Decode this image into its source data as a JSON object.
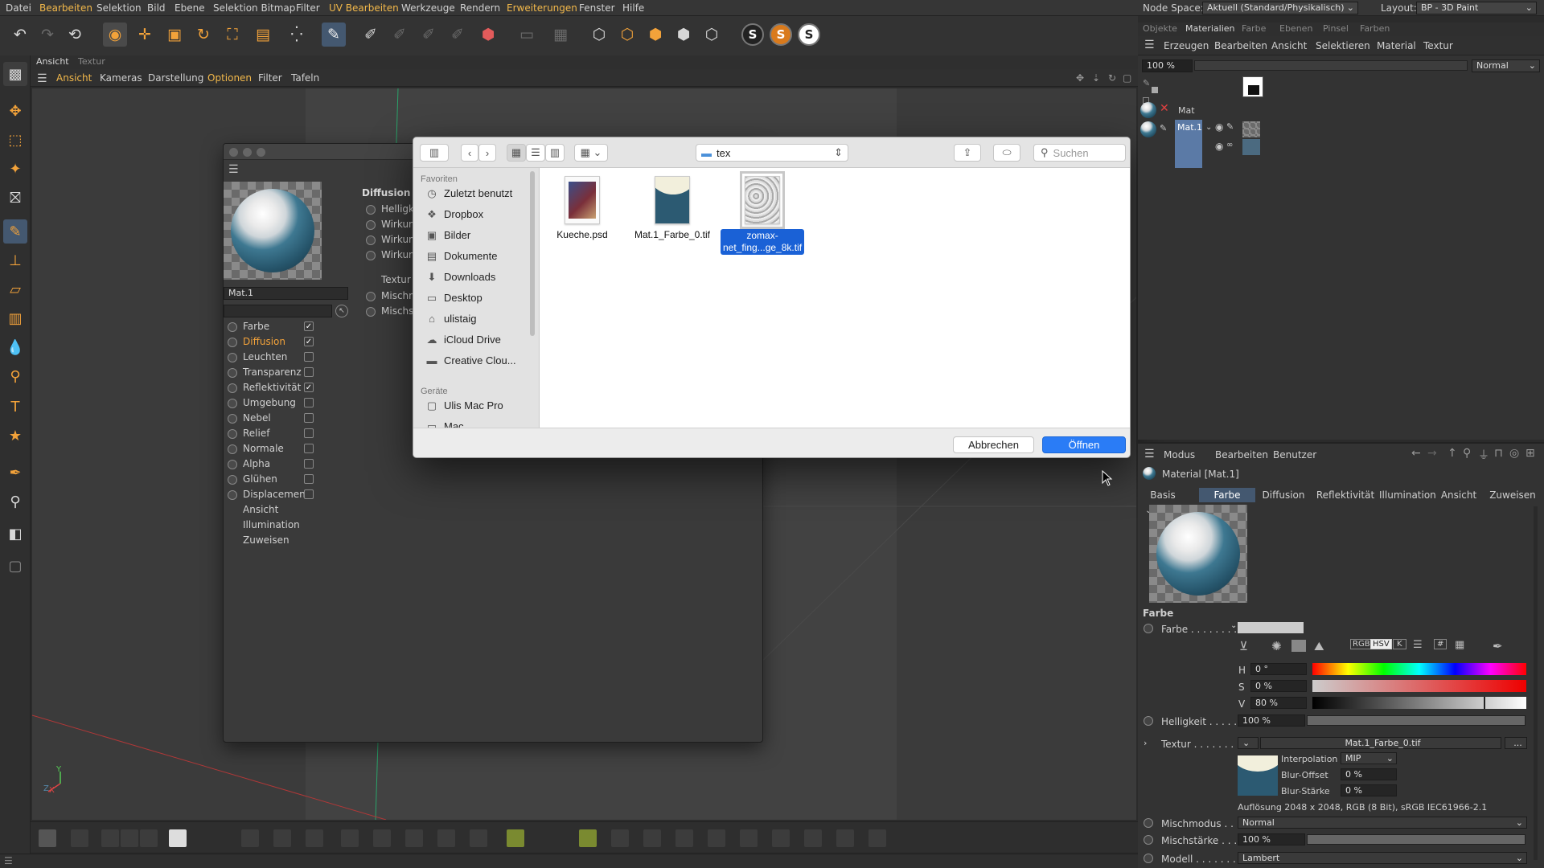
{
  "menubar": {
    "items": [
      "Datei",
      "Bearbeiten",
      "Selektion",
      "Bild",
      "Ebene",
      "Selektion Bitmap",
      "Filter",
      "UV Bearbeiten",
      "Werkzeuge",
      "Rendern",
      "Erweiterungen",
      "Fenster",
      "Hilfe"
    ],
    "node_space_label": "Node Space:",
    "node_space_value": "Aktuell (Standard/Physikalisch)",
    "layout_label": "Layout:",
    "layout_value": "BP - 3D Paint"
  },
  "viewport": {
    "tabs": [
      "Ansicht",
      "Textur"
    ],
    "menu": [
      "Ansicht",
      "Kameras",
      "Darstellung",
      "Optionen",
      "Filter",
      "Tafeln"
    ],
    "axis_y": "Y",
    "axis_z": "Z",
    "axis_x": "X"
  },
  "material_editor": {
    "material_name": "Mat.1",
    "channels": [
      {
        "name": "Farbe",
        "checked": true
      },
      {
        "name": "Diffusion",
        "checked": true,
        "active": true
      },
      {
        "name": "Leuchten",
        "checked": false
      },
      {
        "name": "Transparenz",
        "checked": false
      },
      {
        "name": "Reflektivität",
        "checked": true
      },
      {
        "name": "Umgebung",
        "checked": false
      },
      {
        "name": "Nebel",
        "checked": false
      },
      {
        "name": "Relief",
        "checked": false
      },
      {
        "name": "Normale",
        "checked": false
      },
      {
        "name": "Alpha",
        "checked": false
      },
      {
        "name": "Glühen",
        "checked": false
      },
      {
        "name": "Displacement",
        "checked": false
      }
    ],
    "extra": [
      "Ansicht",
      "Illumination",
      "Zuweisen"
    ],
    "section_title": "Diffusion",
    "props": [
      "Helligke",
      "Wirkung",
      "Wirkung",
      "Wirkung"
    ],
    "textur_label": "Textur",
    "misch": [
      "Mischm",
      "Mischst"
    ]
  },
  "file_dialog": {
    "folder": "tex",
    "search_placeholder": "Suchen",
    "sidebar_favorites_title": "Favoriten",
    "favorites": [
      {
        "label": "Zuletzt benutzt",
        "icon": "clock-icon"
      },
      {
        "label": "Dropbox",
        "icon": "dropbox-icon"
      },
      {
        "label": "Bilder",
        "icon": "pictures-icon"
      },
      {
        "label": "Dokumente",
        "icon": "documents-icon"
      },
      {
        "label": "Downloads",
        "icon": "downloads-icon"
      },
      {
        "label": "Desktop",
        "icon": "desktop-icon"
      },
      {
        "label": "ulistaig",
        "icon": "home-icon"
      },
      {
        "label": "iCloud Drive",
        "icon": "cloud-icon"
      },
      {
        "label": "Creative Clou...",
        "icon": "folder-icon"
      }
    ],
    "sidebar_devices_title": "Geräte",
    "devices": [
      {
        "label": "Ulis Mac Pro",
        "icon": "computer-icon"
      },
      {
        "label": "Mac",
        "icon": "disk-icon"
      }
    ],
    "files": [
      {
        "name": "Kueche.psd",
        "kind": "psd"
      },
      {
        "name": "Mat.1_Farbe_0.tif",
        "kind": "snow"
      },
      {
        "name": "zomax-net_fing...ge_8k.tif",
        "kind": "noise",
        "selected": true
      }
    ],
    "cancel_label": "Abbrechen",
    "open_label": "Öffnen"
  },
  "right_panel": {
    "tabs": [
      "Objekte",
      "Materialien",
      "Farbe",
      "Ebenen",
      "Pinsel",
      "Farben"
    ],
    "active_tab": "Materialien",
    "menu": [
      "Erzeugen",
      "Bearbeiten",
      "Ansicht",
      "Selektieren",
      "Material",
      "Textur"
    ],
    "zoom": "100 %",
    "blend_mode": "Normal",
    "layer_mat": "Mat",
    "layer_mat1": "Mat.1"
  },
  "attributes": {
    "menu": [
      "Modus",
      "Bearbeiten",
      "Benutzer"
    ],
    "title": "Material [Mat.1]",
    "tabs": [
      "Basis",
      "Farbe",
      "Diffusion",
      "Reflektivität",
      "Illumination",
      "Ansicht",
      "Zuweisen"
    ],
    "active_tab": "Farbe",
    "section": "Farbe",
    "farbe_label": "Farbe . . . . . . . .",
    "h_label": "H",
    "h_value": "0 °",
    "s_label": "S",
    "s_value": "0 %",
    "v_label": "V",
    "v_value": "80 %",
    "v_level": 0.8,
    "helligkeit_label": "Helligkeit . . . . . .",
    "helligkeit_value": "100 %",
    "textur_label": "Textur . . . . . . . .",
    "textur_file": "Mat.1_Farbe_0.tif",
    "textur_more": "...",
    "interpolation_label": "Interpolation",
    "interpolation_value": "MIP",
    "blur_offset_label": "Blur-Offset",
    "blur_offset_value": "0 %",
    "blur_staerke_label": "Blur-Stärke",
    "blur_staerke_value": "0 %",
    "resolution": "Auflösung 2048 x 2048, RGB (8 Bit), sRGB IEC61966-2.1",
    "mischmodus_label": "Mischmodus . . .",
    "mischmodus_value": "Normal",
    "mischstaerke_label": "Mischstärke . . .",
    "mischstaerke_value": "100 %",
    "modell_label": "Modell . . . . . . . .",
    "modell_value": "Lambert",
    "color_buttons": [
      "RGB",
      "HSV",
      "K",
      "#"
    ]
  }
}
